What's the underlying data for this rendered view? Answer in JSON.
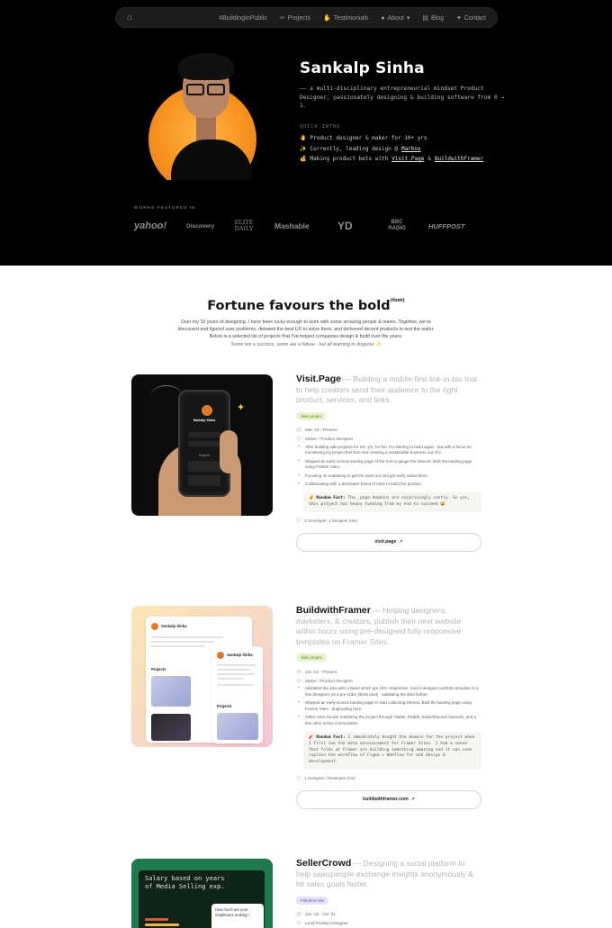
{
  "nav": {
    "items": [
      {
        "label": "#BuildingInPublic",
        "icon": ""
      },
      {
        "label": "Projects",
        "icon": "tools-icon"
      },
      {
        "label": "Testimonials",
        "icon": "thumbs-up-icon"
      },
      {
        "label": "About",
        "icon": "user-icon"
      },
      {
        "label": "Blog",
        "icon": "chat-icon"
      },
      {
        "label": "Contact",
        "icon": "twitter-icon"
      }
    ]
  },
  "hero": {
    "name": "Sankalp Sinha",
    "tagline": "—— a multi-disciplinary entrepreneurial mindset Product Designer, passionately designing & building software from 0 → 1.",
    "quick_intro_label": "QUICK INTRO",
    "quick_intro": {
      "line1": "Product designer & maker for 10+ yrs",
      "line2_prefix": "Currently, leading design @",
      "line2_link": "Marbox",
      "line3_prefix": "Making product bets with",
      "line3_link1": "Visit.Page",
      "line3_amp": "&",
      "line3_link2": "BuildwithFramer"
    },
    "works_featured_label": "WORKS FEATURED IN",
    "logos": [
      "yahoo!",
      "Discovery",
      "ELITE DAILY",
      "Mashable",
      "YD",
      "BBC RADIO",
      "HUFFPOST"
    ]
  },
  "main": {
    "headline": "Fortune favours the bold",
    "headline_sup": "(font)",
    "intro_lines": [
      "Over my 10 years of designing, I have been lucky enough to work with some amazing people & teams. Together, we've",
      "discussed and figured user problems, debated the best UX to solve them, and delivered decent products to test the water.",
      "Below is a selected list of projects that I've helped companies design & build over the years."
    ],
    "intro_italic": "Some are a success, some are a failure - but all learning in disguise ✨"
  },
  "projects": [
    {
      "title": "Visit.Page",
      "desc": "— Building a mobile-first link-in-bio tool to help creators send their audience to the right product, services, and links.",
      "badge": "Side project",
      "date": "Mar '22 - Present",
      "role": "Maker / Product Designer",
      "bullets": [
        "After building side projects for 10+ yrs, for fun, I'm starting to build again - but with a focus on monetising my project this time and creating a sustainable business out of it.",
        "Shipped an early access landing page of the tool to gauge the interest. Built the landing page using Framer Sites.",
        "Focusing on marketing to get the word out and get early subscribers.",
        "Collaborating with a developer friend of mine to build the product."
      ],
      "fact_label": "Random Fact:",
      "fact_text": "The .page domains are surprisingly costly. So yes, this project has heavy funding from my end to succeed 😅",
      "team": "1 Developer, 1 Designer (me)",
      "link": "visit.page"
    },
    {
      "title": "BuildwithFramer",
      "desc": "— Helping designers, marketers, & creators, publish their next website within hours using pre-designed fully-responsive templates on Framer Sites.",
      "badge": "Side project",
      "date": "Jan '22 - Present",
      "role": "Maker / Product Designer",
      "bullets": [
        "Validated the idea with a tweet which got 100+ responses. Sold a designer portfolio template to a few designers as a pre-order ($200 total) - validating the idea further.",
        "Shipped an early access landing page to start collecting interest. Built the landing page using Framer Sites - dogfooding here.",
        "Other roles involve marketing the project through Twitter, Reddit, Slack/Discord channels, and a few other online communities."
      ],
      "fact_label": "Random Fact:",
      "fact_text": "I immediately bought the domain for the project when I first saw the beta announcement for Framer Sites. I had a sense that folks at Framer are building something amazing and it can soon replace the workflow of Figma + Webflow for web design & development.",
      "team": "1 Designer / Developer (me)",
      "link": "buildwithframer.com"
    },
    {
      "title": "SellerCrowd",
      "desc": "— Designing a social platform to help salespeople exchange insights anonymously & hit sales goals faster.",
      "badge": "Full-time role",
      "date": "Jan '18 - Oct '21",
      "role": "Lead Product Designer"
    }
  ],
  "art": {
    "p1_phone_name": "Sankalp Sinha",
    "p1_phone_projects": "Projects",
    "p2_card_name": "Sankalp Sinha",
    "p2_projects": "Projects",
    "p3_heading": "Salary based on years of Media Selling exp.",
    "p3_bubble": "How much are your neighbours making?"
  },
  "colors": {
    "hero_bg": "#000000",
    "badge_side_bg": "#e8f4cf",
    "badge_side_fg": "#5a7a1f",
    "badge_full_bg": "#e6e2fb",
    "badge_full_fg": "#5b4bc4"
  }
}
